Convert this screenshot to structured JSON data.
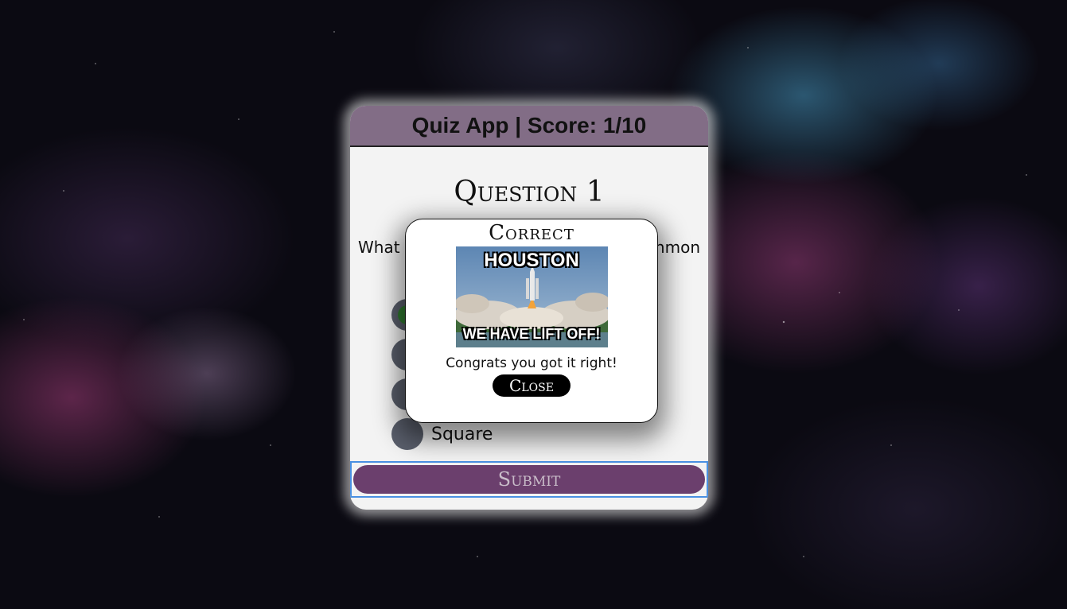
{
  "header": {
    "title": "Quiz App | Score: 1/10"
  },
  "question": {
    "title": "Question 1",
    "text_left": "What",
    "text_right": "nmon"
  },
  "answers": [
    {
      "label": "",
      "selected": true
    },
    {
      "label": "",
      "selected": false
    },
    {
      "label": "",
      "selected": false
    },
    {
      "label": "Square",
      "selected": false
    }
  ],
  "submit": {
    "label": "Submit"
  },
  "modal": {
    "title": "Correct",
    "image_top_text": "HOUSTON",
    "image_bottom_text": "WE HAVE LIFT OFF!",
    "message": "Congrats you got it right!",
    "close_label": "Close"
  },
  "colors": {
    "header_bg": "#826d86",
    "submit_bg": "#6b3f6d",
    "focus_outline": "#4a90e2"
  }
}
